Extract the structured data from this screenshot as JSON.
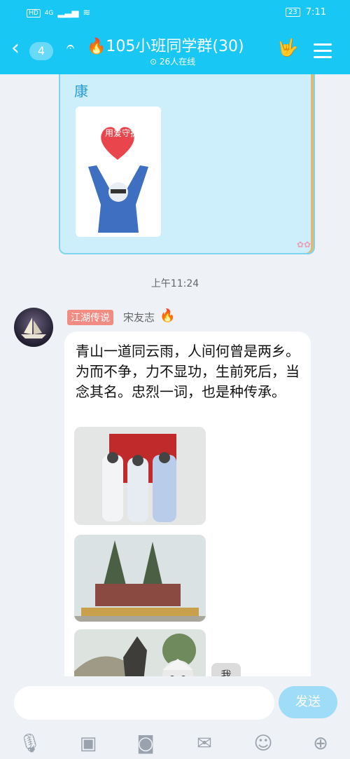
{
  "status": {
    "network": "4G",
    "battery": "23",
    "time": "7:11"
  },
  "header": {
    "back_count": "4",
    "title": "105小班同学群(30)",
    "online": "26人在线"
  },
  "previous_message": {
    "tail_text": "康",
    "poster_heart_text": "用爱守护"
  },
  "time_divider": "上午11:24",
  "message": {
    "tag": "江湖传说",
    "nickname": "宋友志",
    "text": "青山一道同云雨，人间何曾是两乡。为而不争，力不显功，生前死后，当念其名。忠烈一词，也是种传承。"
  },
  "me_label": "我",
  "input": {
    "placeholder": "",
    "send_label": "发送"
  },
  "colors": {
    "accent": "#18c7f4",
    "tag_bg": "#f28b82",
    "send_bg": "#9fdcf7"
  },
  "toolbar_icons": [
    "microphone-icon",
    "image-icon",
    "camera-icon",
    "redpacket-icon",
    "emoji-icon",
    "plus-icon"
  ]
}
